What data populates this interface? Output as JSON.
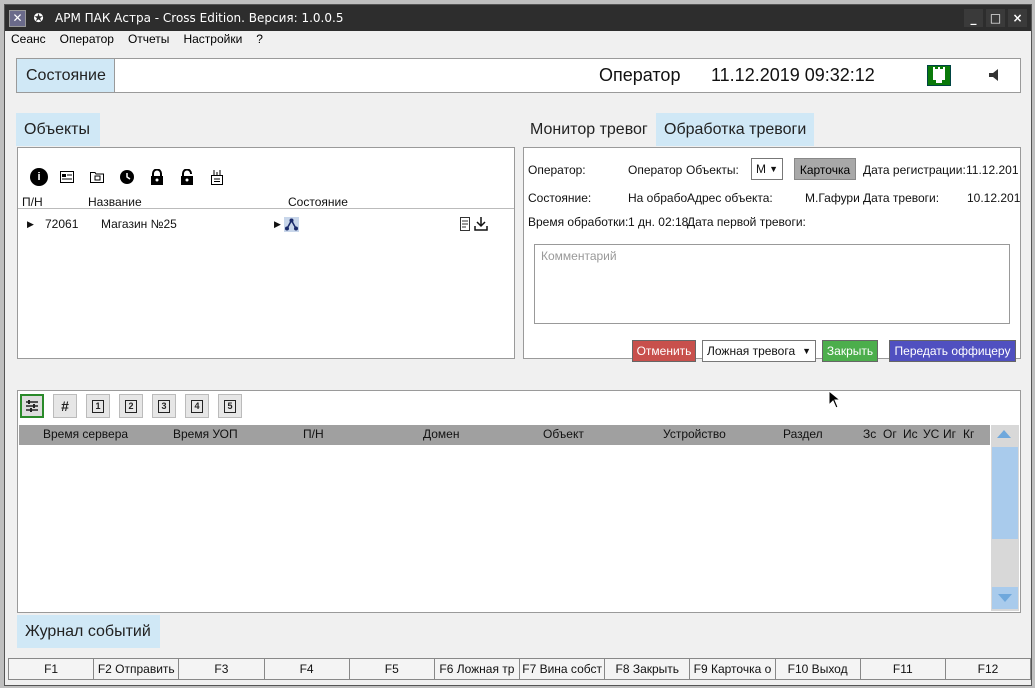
{
  "window": {
    "title": "АРМ ПАК Астра - Cross Edition. Версия: 1.0.0.5",
    "controls": [
      "_",
      "□",
      "×"
    ]
  },
  "menu": [
    "Сеанс",
    "Оператор",
    "Отчеты",
    "Настройки",
    "?"
  ],
  "status": {
    "label": "Состояние",
    "operator": "Оператор",
    "datetime": "11.12.2019 09:32:12",
    "icons": [
      "network-icon",
      "speaker-icon"
    ],
    "network_color": "#0a7a0a"
  },
  "objects": {
    "label": "Объекты",
    "toolbar_icons": [
      "info-icon",
      "card-icon",
      "folder-icon",
      "history-icon",
      "lock-icon",
      "lock-open-icon",
      "device-icon"
    ],
    "columns": [
      "П/Н",
      "Название",
      "Состояние"
    ],
    "rows": [
      {
        "pn": "72061",
        "name": "Магазин №25",
        "state_icon": "network-node-icon"
      }
    ]
  },
  "alarm": {
    "tabs": [
      "Монитор тревог",
      "Обработка тревоги"
    ],
    "active_tab": "Обработка тревоги",
    "fields": {
      "operator_label": "Оператор:",
      "operator_value": "Оператор",
      "objects_label": "Объекты:",
      "objects_value": "М",
      "card_button": "Карточка",
      "reg_date_label": "Дата регистрации:",
      "reg_date_value": "11.12.201",
      "state_label": "Состояние:",
      "state_value": "На обрабо",
      "address_label": "Адрес объекта:",
      "address_value": "М.Гафури",
      "alarm_date_label": "Дата тревоги:",
      "alarm_date_value": "10.12.201",
      "processing_time_label": "Время обработки:",
      "processing_time_value": "1 дн. 02:18",
      "first_alarm_label": "Дата первой тревоги:"
    },
    "comment_placeholder": "Комментарий",
    "actions": {
      "cancel": "Отменить",
      "false_alarm": "Ложная тревога",
      "close": "Закрыть",
      "transfer": "Передать оффицеру"
    },
    "colors": {
      "cancel": "#c8504c",
      "close": "#4cae4c",
      "transfer": "#5050c0"
    }
  },
  "events": {
    "label": "Журнал событий",
    "toolbar": [
      "filter-icon",
      "#",
      "1",
      "2",
      "3",
      "4",
      "5"
    ],
    "columns": [
      "Время сервера",
      "Время УОП",
      "П/Н",
      "Домен",
      "Объект",
      "Устройство",
      "Раздел",
      "Зс",
      "Ог",
      "Ис",
      "УС",
      "Иг",
      "Кг"
    ]
  },
  "fkeys": [
    "F1",
    "F2 Отправить",
    "F3",
    "F4",
    "F5",
    "F6 Ложная тр",
    "F7 Вина собст",
    "F8 Закрыть",
    "F9 Карточка о",
    "F10 Выход",
    "F11",
    "F12"
  ]
}
